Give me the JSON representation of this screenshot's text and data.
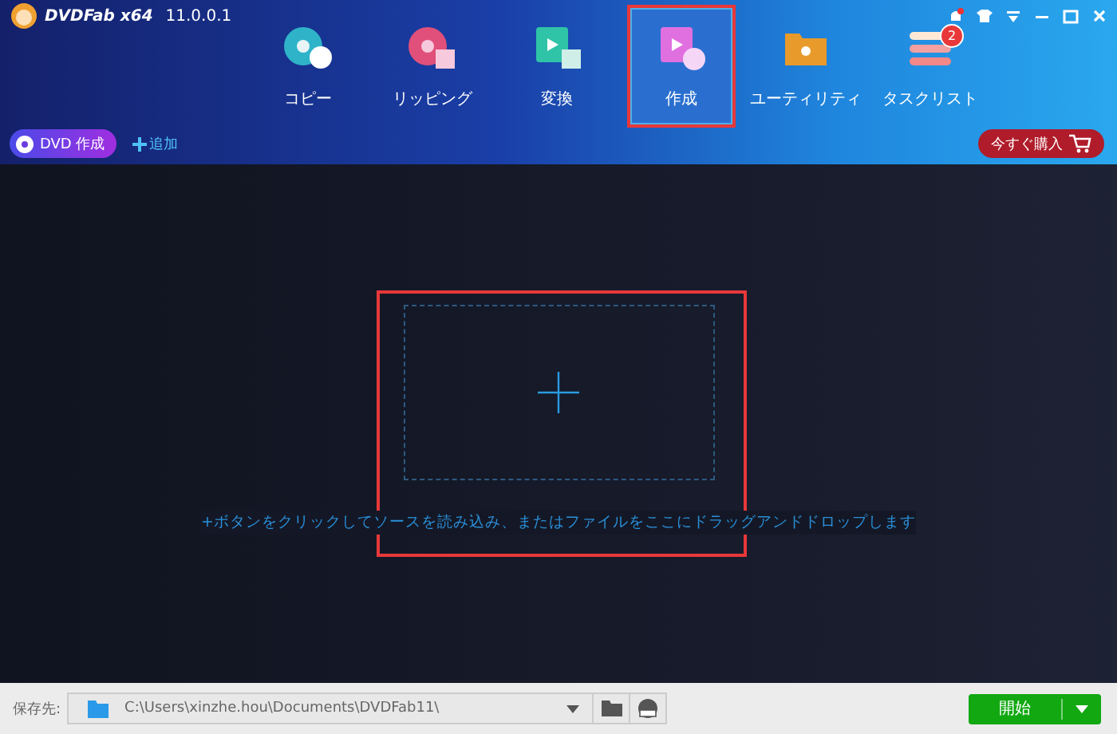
{
  "app": {
    "logo_text": "DVDFab x64",
    "version": "11.0.0.1"
  },
  "tabs": [
    {
      "label": "コピー",
      "kind": "copy",
      "selected": false
    },
    {
      "label": "リッピング",
      "kind": "rip",
      "selected": false
    },
    {
      "label": "変換",
      "kind": "convert",
      "selected": false
    },
    {
      "label": "作成",
      "kind": "create",
      "selected": true
    },
    {
      "label": "ユーティリティ",
      "kind": "utility",
      "selected": false
    },
    {
      "label": "タスクリスト",
      "kind": "tasks",
      "selected": false,
      "badge": "2"
    }
  ],
  "mode_button": "DVD 作成",
  "add_button": "追加",
  "buy_button": "今すぐ購入",
  "drop_hint": "+ボタンをクリックしてソースを読み込み、またはファイルをここにドラッグアンドドロップします",
  "save": {
    "label": "保存先:",
    "path": "C:\\Users\\xinzhe.hou\\Documents\\DVDFab11\\"
  },
  "start_button": "開始"
}
